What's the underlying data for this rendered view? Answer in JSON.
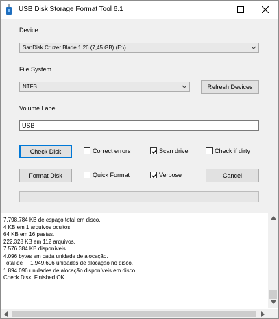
{
  "window": {
    "title": "USB Disk Storage Format Tool 6.1",
    "icon": "usb-drive-icon"
  },
  "device": {
    "label": "Device",
    "selected": "SanDisk  Cruzer Blade  1.26 (7,45 GB) (E:\\)"
  },
  "file_system": {
    "label": "File System",
    "selected": "NTFS",
    "refresh_label": "Refresh Devices"
  },
  "volume": {
    "label": "Volume Label",
    "value": "USB"
  },
  "actions": {
    "check_disk_label": "Check Disk",
    "format_disk_label": "Format Disk",
    "cancel_label": "Cancel"
  },
  "options": {
    "correct_errors": {
      "label": "Correct errors",
      "checked": false
    },
    "scan_drive": {
      "label": "Scan drive",
      "checked": true
    },
    "check_if_dirty": {
      "label": "Check if dirty",
      "checked": false
    },
    "quick_format": {
      "label": "Quick Format",
      "checked": false
    },
    "verbose": {
      "label": "Verbose",
      "checked": true
    }
  },
  "log": {
    "lines": [
      "7.798.784 KB de espaço total em disco.",
      "4 KB em 1 arquivos ocultos.",
      "64 KB em 16 pastas.",
      "222.328 KB em 112 arquivos.",
      "7.576.384 KB disponíveis.",
      "4.096 bytes em cada unidade de alocação.",
      "Total de     1.949.696 unidades de alocação no disco.",
      "1.894.096 unidades de alocação disponíveis em disco.",
      "Check Disk: Finished OK"
    ]
  },
  "colors": {
    "accent": "#0078d7",
    "window_bg": "#f0f0f0"
  }
}
